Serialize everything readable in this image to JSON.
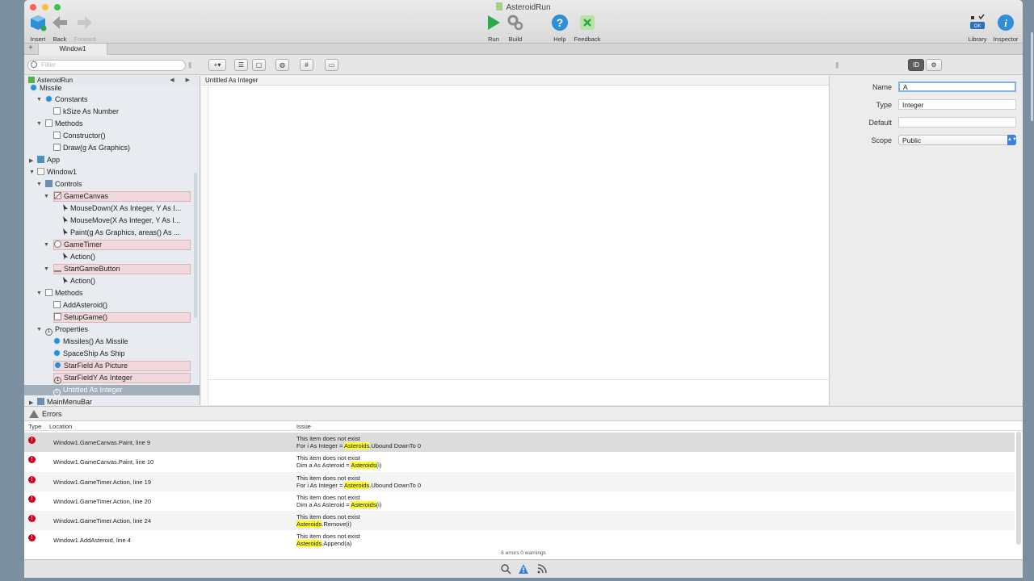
{
  "window": {
    "title": "AsteroidRun"
  },
  "toolbar": {
    "insert": "Insert",
    "back": "Back",
    "forward": "Forward",
    "run": "Run",
    "build": "Build",
    "help": "Help",
    "feedback": "Feedback",
    "library": "Library",
    "inspector": "Inspector"
  },
  "tabs": {
    "plus": "+",
    "active": "Window1"
  },
  "filter": {
    "placeholder": "Filter"
  },
  "navigator": {
    "project": "AsteroidRun",
    "items": [
      {
        "label": "Missile"
      },
      {
        "label": "Constants"
      },
      {
        "label": "kSize As Number"
      },
      {
        "label": "Methods"
      },
      {
        "label": "Constructor()"
      },
      {
        "label": "Draw(g As Graphics)"
      },
      {
        "label": "App"
      },
      {
        "label": "Window1"
      },
      {
        "label": "Controls"
      },
      {
        "label": "GameCanvas"
      },
      {
        "label": "MouseDown(X As Integer, Y As I..."
      },
      {
        "label": "MouseMove(X As Integer, Y As I..."
      },
      {
        "label": "Paint(g As Graphics, areas() As ..."
      },
      {
        "label": "GameTimer"
      },
      {
        "label": "Action()"
      },
      {
        "label": "StartGameButton"
      },
      {
        "label": "Action()"
      },
      {
        "label": "Methods"
      },
      {
        "label": "AddAsteroid()"
      },
      {
        "label": "SetupGame()"
      },
      {
        "label": "Properties"
      },
      {
        "label": "Missiles() As Missile"
      },
      {
        "label": "SpaceShip As Ship"
      },
      {
        "label": "StarField As Picture"
      },
      {
        "label": "StarFieldY As Integer"
      },
      {
        "label": "Untitled As Integer"
      },
      {
        "label": "MainMenuBar"
      }
    ]
  },
  "editor": {
    "header": "Untitled As Integer"
  },
  "inspector": {
    "name_label": "Name",
    "name_value": "A",
    "type_label": "Type",
    "type_value": "Integer",
    "default_label": "Default",
    "default_value": "",
    "scope_label": "Scope",
    "scope_value": "Public"
  },
  "errors": {
    "title": "Errors",
    "columns": {
      "type": "Type",
      "location": "Location",
      "issue": "Issue"
    },
    "rows": [
      {
        "location": "Window1.GameCanvas.Paint, line 9",
        "msg": "This item does not exist",
        "code_pre": "For i As Integer = ",
        "code_hl": "Asteroids",
        "code_post": ".Ubound DownTo 0"
      },
      {
        "location": "Window1.GameCanvas.Paint, line 10",
        "msg": "This item does not exist",
        "code_pre": "Dim a As Asteroid = ",
        "code_hl": "Asteroids",
        "code_post": "(i)"
      },
      {
        "location": "Window1.GameTimer.Action, line 19",
        "msg": "This item does not exist",
        "code_pre": "For i As Integer = ",
        "code_hl": "Asteroids",
        "code_post": ".Ubound DownTo 0"
      },
      {
        "location": "Window1.GameTimer.Action, line 20",
        "msg": "This item does not exist",
        "code_pre": "Dim a As Asteroid = ",
        "code_hl": "Asteroids",
        "code_post": "(i)"
      },
      {
        "location": "Window1.GameTimer.Action, line 24",
        "msg": "This item does not exist",
        "code_pre": "",
        "code_hl": "Asteroids",
        "code_post": ".Remove(i)"
      },
      {
        "location": "Window1.AddAsteroid, line 4",
        "msg": "This item does not exist",
        "code_pre": "",
        "code_hl": "Asteroids",
        "code_post": ".Append(a)"
      }
    ],
    "summary": "6 errors 0 warnings"
  },
  "colors": {
    "accent": "#3b82e0",
    "error": "#d0021b",
    "highlight": "#fffb2e",
    "selection_pink": "#f1d8dc"
  }
}
